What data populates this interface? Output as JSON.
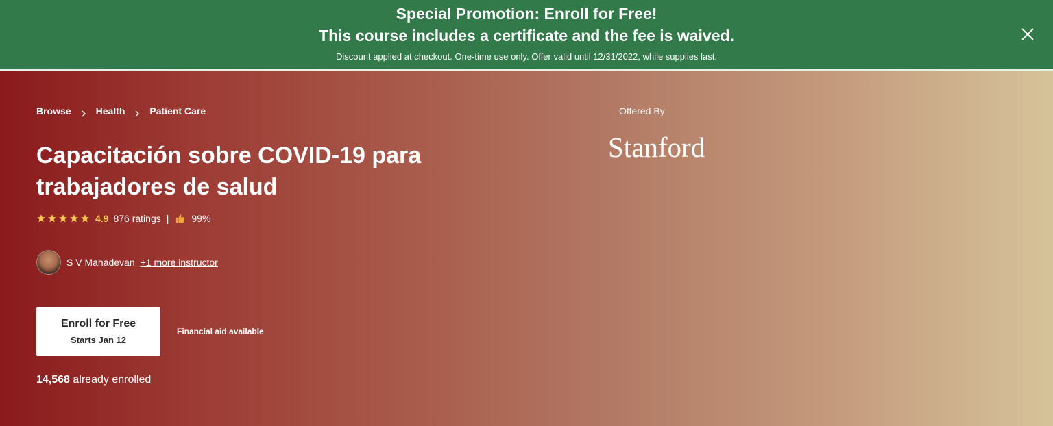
{
  "promo": {
    "headline": "Special Promotion: Enroll for Free!",
    "subheadline": "This course includes a certificate and the fee is waived.",
    "fine_print": "Discount applied at checkout. One-time use only. Offer valid until 12/31/2022, while supplies last.",
    "close_icon": "close-icon",
    "background_color": "#327a4a"
  },
  "breadcrumb": {
    "items": [
      "Browse",
      "Health",
      "Patient Care"
    ],
    "separator_icon": "chevron-right-icon"
  },
  "course": {
    "title": "Capacitación sobre COVID-19 para trabajadores de salud",
    "rating": {
      "stars": 5,
      "score": "4.9",
      "count_text": "876 ratings",
      "divider": "|",
      "like_icon": "thumbs-up-icon",
      "like_percent": "99%"
    },
    "instructor": {
      "name": "S V Mahadevan",
      "more_link": "+1 more instructor"
    },
    "enroll_button": {
      "label": "Enroll for Free",
      "sublabel": "Starts Jan 12"
    },
    "financial_aid": "Financial aid available",
    "enrolled": {
      "count": "14,568",
      "suffix": "already enrolled"
    }
  },
  "partner": {
    "offered_by": "Offered By",
    "name": "Stanford"
  },
  "colors": {
    "rating_star": "#f5c451",
    "hero_gradient_start": "#8a1a1c",
    "hero_gradient_end": "#d6c39a"
  }
}
